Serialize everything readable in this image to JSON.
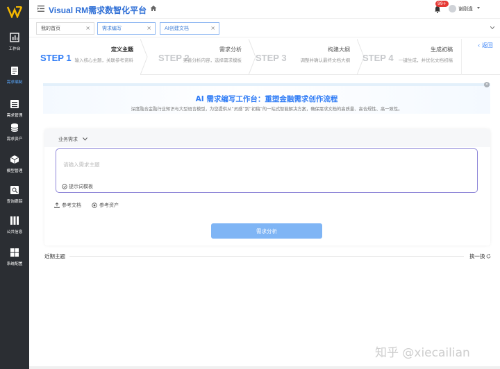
{
  "header": {
    "app_title": "Visual RM需求数智化平台",
    "notification_count": "99+",
    "username": "谢刚逢"
  },
  "sidebar": {
    "items": [
      {
        "label": "工作台",
        "icon": "dashboard-icon",
        "active": false
      },
      {
        "label": "需求编制",
        "icon": "document-edit-icon",
        "active": true
      },
      {
        "label": "需求管理",
        "icon": "list-icon",
        "active": false
      },
      {
        "label": "需求资产",
        "icon": "database-icon",
        "active": false
      },
      {
        "label": "模型管理",
        "icon": "cube-icon",
        "active": false
      },
      {
        "label": "查询跟踪",
        "icon": "search-icon",
        "active": false
      },
      {
        "label": "公共信息",
        "icon": "books-icon",
        "active": false
      },
      {
        "label": "系统配置",
        "icon": "windows-icon",
        "active": false
      }
    ]
  },
  "tabs": [
    {
      "label": "我的首页",
      "active": false
    },
    {
      "label": "需求编写",
      "active": true
    },
    {
      "label": "AI创建文档",
      "active": true
    }
  ],
  "steps": [
    {
      "num": "STEP 1",
      "name": "定义主题",
      "desc": "输入核心主题，关联参考资料",
      "active": true
    },
    {
      "num": "STEP 2",
      "name": "需求分析",
      "desc": "完善分析内容，选择需求模板",
      "active": false
    },
    {
      "num": "STEP 3",
      "name": "构建大纲",
      "desc": "调整并确认最终文档大纲",
      "active": false
    },
    {
      "num": "STEP 4",
      "name": "生成初稿",
      "desc": "一键生成，并优化文档初稿",
      "active": false
    }
  ],
  "back_label": "返回",
  "banner": {
    "title": "AI 需求编写工作台：重塑金融需求创作流程",
    "subtitle": "深度融合金融行业知识与大型语言模型，为您提供从“灵感”到“初稿”的一站式智能解决方案，确保需求文档的高质量、高合规性、高一致性。"
  },
  "form": {
    "requirement_type": "业务需求",
    "topic_placeholder": "请输入需求主题",
    "template_hint": "提示词模板",
    "ref_doc": "参考文档",
    "ref_asset": "参考资产",
    "analyze_button": "需求分析"
  },
  "recent": {
    "title": "近期主题",
    "refresh": "换一换"
  },
  "watermark": "知乎 @xiecailian",
  "colors": {
    "sidebar_bg": "#2b2e33",
    "accent": "#2f7cf6",
    "button": "#7fb5f5"
  }
}
